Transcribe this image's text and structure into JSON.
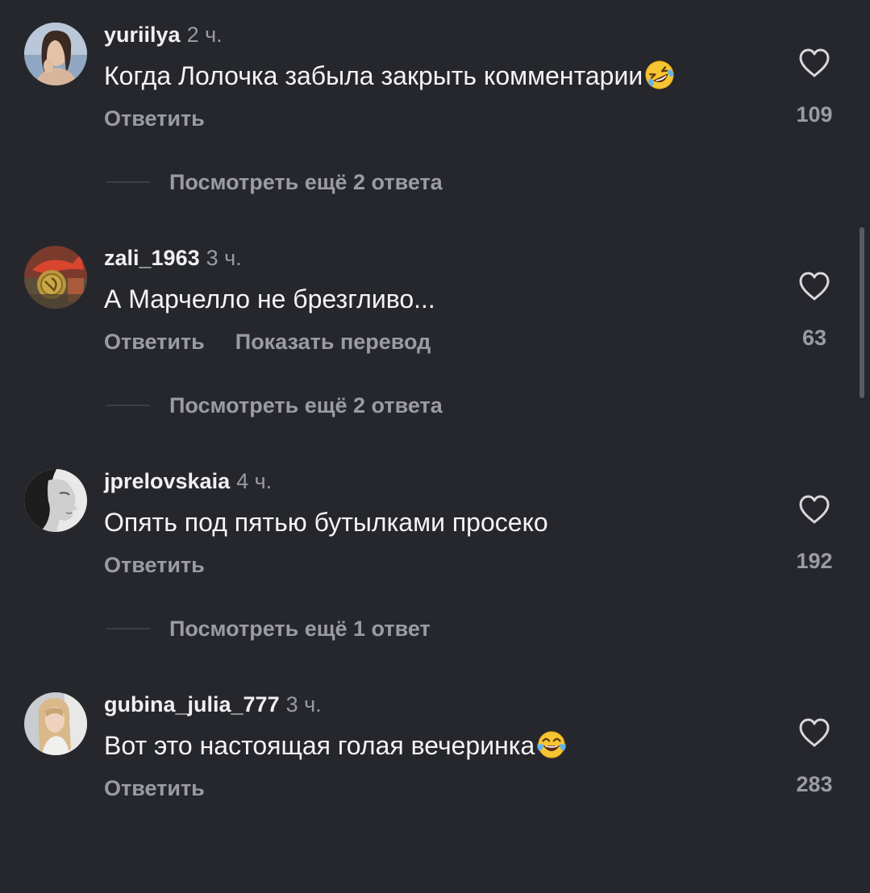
{
  "comments": [
    {
      "username": "yuriilya",
      "time": "2 ч.",
      "text": "Когда Лолочка забыла закрыть комментарии",
      "emoji": "rolling-on-floor-laughing",
      "reply_label": "Ответить",
      "translate_label": "",
      "likes": "109",
      "more_replies": "Посмотреть ещё 2 ответа"
    },
    {
      "username": "zali_1963",
      "time": "3 ч.",
      "text": "А Марчелло не брезгливо...",
      "emoji": "",
      "reply_label": "Ответить",
      "translate_label": "Показать перевод",
      "likes": "63",
      "more_replies": "Посмотреть ещё 2 ответа"
    },
    {
      "username": "jprelovskaia",
      "time": "4 ч.",
      "text": "Опять под пятью бутылками просеко",
      "emoji": "",
      "reply_label": "Ответить",
      "translate_label": "",
      "likes": "192",
      "more_replies": "Посмотреть ещё 1 ответ"
    },
    {
      "username": "gubina_julia_777",
      "time": "3 ч.",
      "text": "Вот это настоящая голая вечеринка",
      "emoji": "face-with-tears-of-joy",
      "reply_label": "Ответить",
      "translate_label": "",
      "likes": "283",
      "more_replies": ""
    }
  ],
  "icons": {
    "like": "heart-outline-icon"
  },
  "colors": {
    "background": "#26272c",
    "primary_text": "#f4f4f4",
    "secondary_text": "#9b9ca1"
  }
}
